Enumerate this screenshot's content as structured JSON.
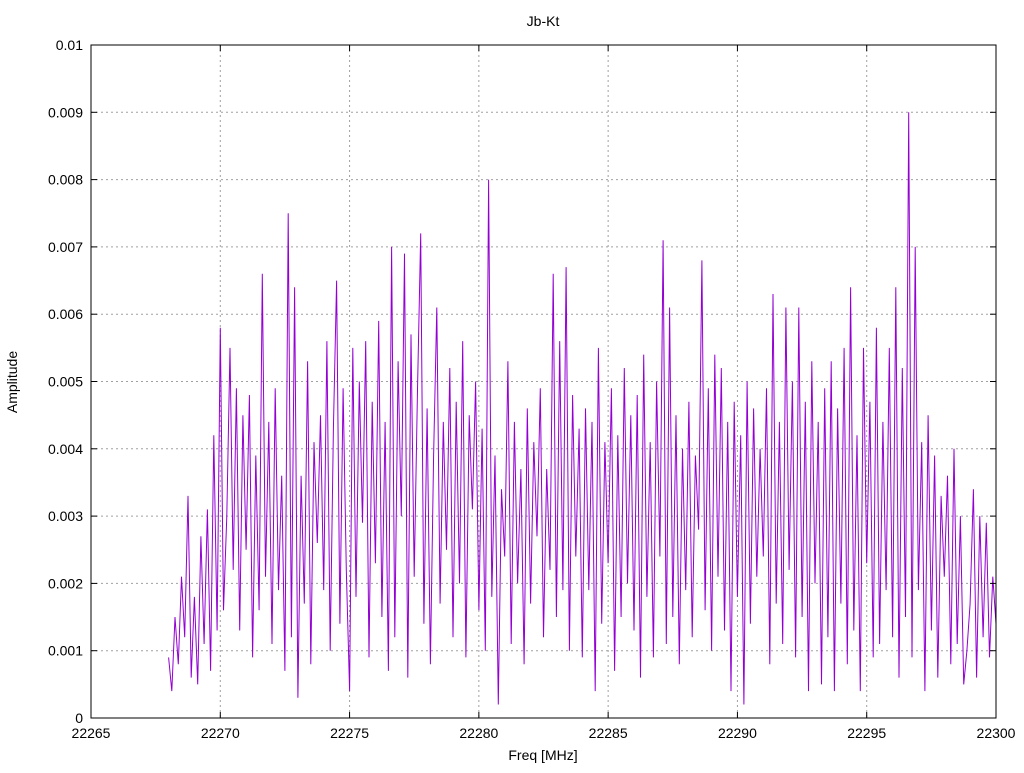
{
  "chart_data": {
    "type": "line",
    "title": "Jb-Kt",
    "xlabel": "Freq [MHz]",
    "ylabel": "Amplitude",
    "xlim": [
      22265,
      22300
    ],
    "ylim": [
      0,
      0.01
    ],
    "grid": true,
    "x_ticks": [
      "22265",
      "22270",
      "22275",
      "22280",
      "22285",
      "22290",
      "22295",
      "22300"
    ],
    "y_ticks": [
      "0",
      "0.001",
      "0.002",
      "0.003",
      "0.004",
      "0.005",
      "0.006",
      "0.007",
      "0.008",
      "0.009",
      "0.01"
    ],
    "series": [
      {
        "name": "Jb-Kt",
        "color": "#9400d3",
        "x_start": 22268.0,
        "x_step": 0.125,
        "values": [
          0.0009,
          0.0004,
          0.0015,
          0.0008,
          0.0021,
          0.0012,
          0.0033,
          0.0006,
          0.0018,
          0.0005,
          0.0027,
          0.0011,
          0.0031,
          0.0007,
          0.0042,
          0.0013,
          0.0058,
          0.0016,
          0.003,
          0.0055,
          0.0022,
          0.0049,
          0.0013,
          0.0045,
          0.0025,
          0.0048,
          0.0009,
          0.0039,
          0.0016,
          0.0066,
          0.0021,
          0.0044,
          0.0011,
          0.0049,
          0.0019,
          0.0036,
          0.0007,
          0.0075,
          0.0012,
          0.0064,
          0.0003,
          0.0036,
          0.0017,
          0.0053,
          0.0008,
          0.0041,
          0.0026,
          0.0045,
          0.0019,
          0.0056,
          0.001,
          0.0043,
          0.0065,
          0.0014,
          0.0049,
          0.0022,
          0.0004,
          0.0055,
          0.0018,
          0.005,
          0.0029,
          0.0056,
          0.0009,
          0.0047,
          0.0023,
          0.0059,
          0.0015,
          0.0044,
          0.0007,
          0.007,
          0.0012,
          0.0053,
          0.003,
          0.0069,
          0.0006,
          0.0057,
          0.0021,
          0.0048,
          0.0072,
          0.0014,
          0.0046,
          0.0008,
          0.0039,
          0.0061,
          0.0017,
          0.0044,
          0.0025,
          0.0052,
          0.0012,
          0.0047,
          0.002,
          0.0056,
          0.0009,
          0.0045,
          0.0031,
          0.005,
          0.0016,
          0.0043,
          0.001,
          0.008,
          0.0018,
          0.0039,
          0.0002,
          0.0034,
          0.0024,
          0.0053,
          0.0011,
          0.0044,
          0.002,
          0.0037,
          0.0008,
          0.0046,
          0.0017,
          0.0041,
          0.0027,
          0.0049,
          0.0012,
          0.0037,
          0.0022,
          0.0066,
          0.0015,
          0.0056,
          0.0019,
          0.0067,
          0.001,
          0.0048,
          0.0024,
          0.0043,
          0.0009,
          0.0046,
          0.0019,
          0.0044,
          0.0004,
          0.0055,
          0.0014,
          0.0041,
          0.0023,
          0.0049,
          0.0007,
          0.0042,
          0.0015,
          0.0052,
          0.002,
          0.0045,
          0.0013,
          0.0048,
          0.0006,
          0.0054,
          0.0018,
          0.0041,
          0.0009,
          0.005,
          0.0024,
          0.0071,
          0.0011,
          0.0061,
          0.0015,
          0.0045,
          0.0008,
          0.004,
          0.0019,
          0.0047,
          0.0012,
          0.0039,
          0.0028,
          0.0068,
          0.0016,
          0.0049,
          0.001,
          0.0054,
          0.0021,
          0.0052,
          0.0013,
          0.0044,
          0.0004,
          0.0047,
          0.0018,
          0.0042,
          0.0002,
          0.005,
          0.0014,
          0.0046,
          0.0021,
          0.004,
          0.0024,
          0.0049,
          0.0008,
          0.0063,
          0.0017,
          0.0044,
          0.0011,
          0.0061,
          0.0022,
          0.005,
          0.0009,
          0.0061,
          0.0015,
          0.0047,
          0.0004,
          0.0053,
          0.002,
          0.0044,
          0.0005,
          0.0049,
          0.0012,
          0.0053,
          0.0004,
          0.0046,
          0.0017,
          0.0055,
          0.0008,
          0.0064,
          0.0013,
          0.0042,
          0.0004,
          0.0055,
          0.0023,
          0.0047,
          0.0009,
          0.0058,
          0.0011,
          0.0044,
          0.0019,
          0.0055,
          0.0012,
          0.0064,
          0.0006,
          0.0052,
          0.0015,
          0.009,
          0.0009,
          0.007,
          0.0019,
          0.0041,
          0.0004,
          0.0045,
          0.0013,
          0.0039,
          0.0006,
          0.0033,
          0.0021,
          0.0036,
          0.0008,
          0.004,
          0.0011,
          0.003,
          0.0005,
          0.001,
          0.0017,
          0.0034,
          0.0006,
          0.003,
          0.0012,
          0.0029,
          0.0009,
          0.0021,
          0.0014
        ]
      }
    ]
  }
}
